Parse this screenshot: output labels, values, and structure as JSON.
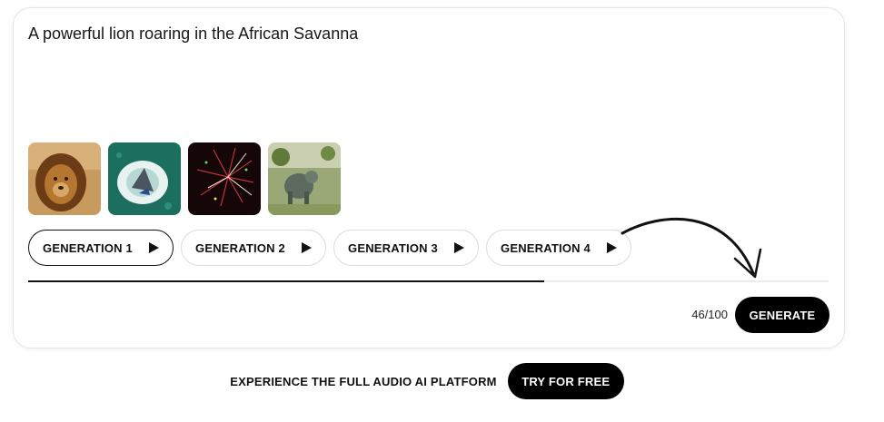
{
  "prompt": {
    "text": "A powerful lion roaring in the African Savanna"
  },
  "thumbnails": [
    {
      "icon": "lion-image",
      "description_color": "#b98a4f"
    },
    {
      "icon": "shark-water-image",
      "description_color": "#1e6f5c"
    },
    {
      "icon": "fireworks-image",
      "description_color": "#1a0a0e"
    },
    {
      "icon": "animal-field-image",
      "description_color": "#7e8a55"
    }
  ],
  "generations": [
    {
      "label": "GENERATION 1",
      "active": true
    },
    {
      "label": "GENERATION 2",
      "active": false
    },
    {
      "label": "GENERATION 3",
      "active": false
    },
    {
      "label": "GENERATION 4",
      "active": false
    }
  ],
  "progress": {
    "fraction": 0.645
  },
  "counter": {
    "text": "46/100"
  },
  "generate": {
    "label": "GENERATE"
  },
  "footer": {
    "text": "EXPERIENCE THE FULL AUDIO AI PLATFORM",
    "cta_label": "TRY FOR FREE"
  },
  "colors": {
    "primary": "#000000",
    "background": "#ffffff",
    "border": "#e6e6e6"
  }
}
